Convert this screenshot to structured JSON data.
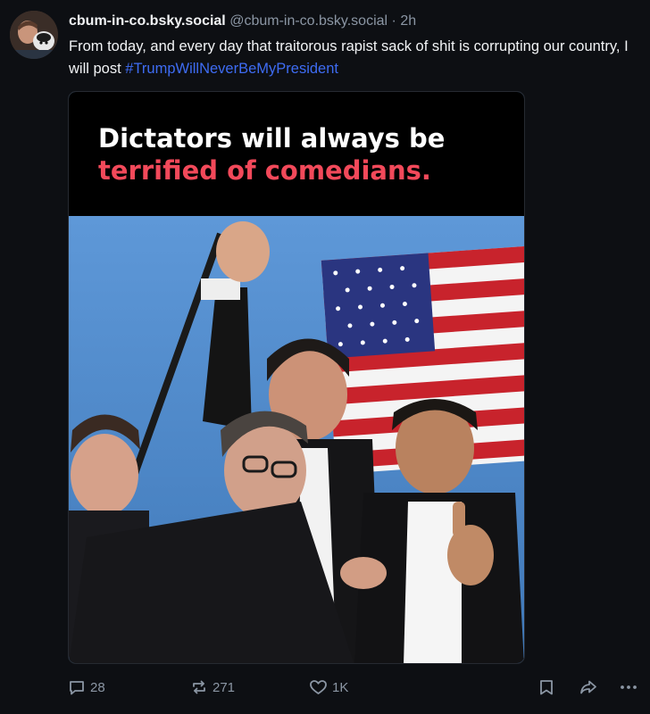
{
  "post": {
    "display_name": "cbum-in-co.bsky.social",
    "handle": "@cbum-in-co.bsky.social",
    "separator": "·",
    "timestamp": "2h",
    "text_before_hashtag": "From today, and every day that traitorous rapist sack of shit is corrupting our country, I will post ",
    "hashtag": "#TrumpWillNeverBeMyPresident"
  },
  "image": {
    "caption_line1": "Dictators will always be",
    "caption_line2": "terrified of comedians."
  },
  "actions": {
    "reply_count": "28",
    "repost_count": "271",
    "like_count": "1K"
  },
  "colors": {
    "background": "#0d0f13",
    "hashtag": "#3e6cf3",
    "caption_accent": "#f2495a",
    "muted": "#8b96a4"
  },
  "icons": [
    "reply-icon",
    "repost-icon",
    "like-icon",
    "bookmark-icon",
    "share-icon",
    "more-icon"
  ]
}
